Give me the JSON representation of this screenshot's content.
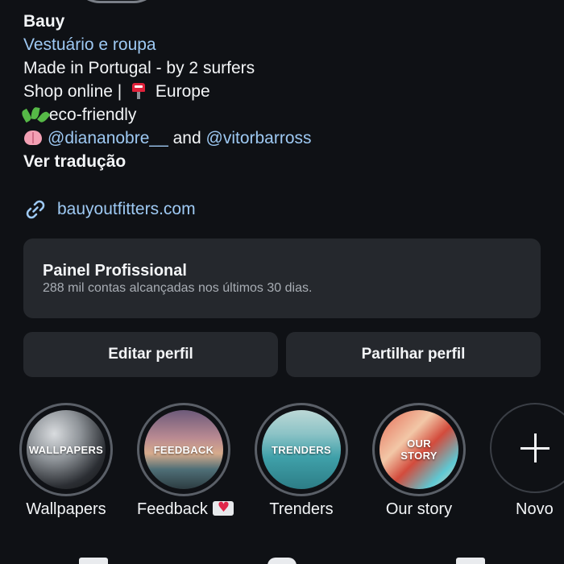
{
  "profile": {
    "name": "Bauy",
    "category": "Vestuário e roupa",
    "bio_lines": {
      "line1": "Made in Portugal - by 2 surfers",
      "line2_prefix": "Shop online |",
      "line2_suffix": "Europe",
      "line3": "eco-friendly",
      "mention1": "@diananobre__",
      "joiner": "and",
      "mention2": "@vitorbarross"
    },
    "translate_label": "Ver tradução",
    "website": "bauyoutfitters.com"
  },
  "dashboard": {
    "title": "Painel Profissional",
    "subtitle": "288 mil contas alcançadas nos últimos 30 dias."
  },
  "actions": {
    "edit_label": "Editar perfil",
    "share_label": "Partilhar perfil"
  },
  "highlights": [
    {
      "name": "Wallpapers",
      "cover_text": "WALLPAPERS"
    },
    {
      "name": "Feedback",
      "cover_text": "FEEDBACK"
    },
    {
      "name": "Trenders",
      "cover_text": "TRENDERS"
    },
    {
      "name": "Our story",
      "cover_text": "OUR STORY"
    },
    {
      "name": "Novo"
    }
  ],
  "icons": {
    "mailbox": "mailbox-emoji",
    "leaves": "herb-seedling-emoji",
    "brain": "brain-emoji",
    "link": "link-icon",
    "heart_letter": "love-letter-emoji",
    "add": "plus-icon"
  },
  "colors": {
    "background": "#0f1115",
    "link": "#9ec9f3",
    "card": "#25282d",
    "text": "#f3f5f7",
    "muted": "#a8adb4"
  }
}
